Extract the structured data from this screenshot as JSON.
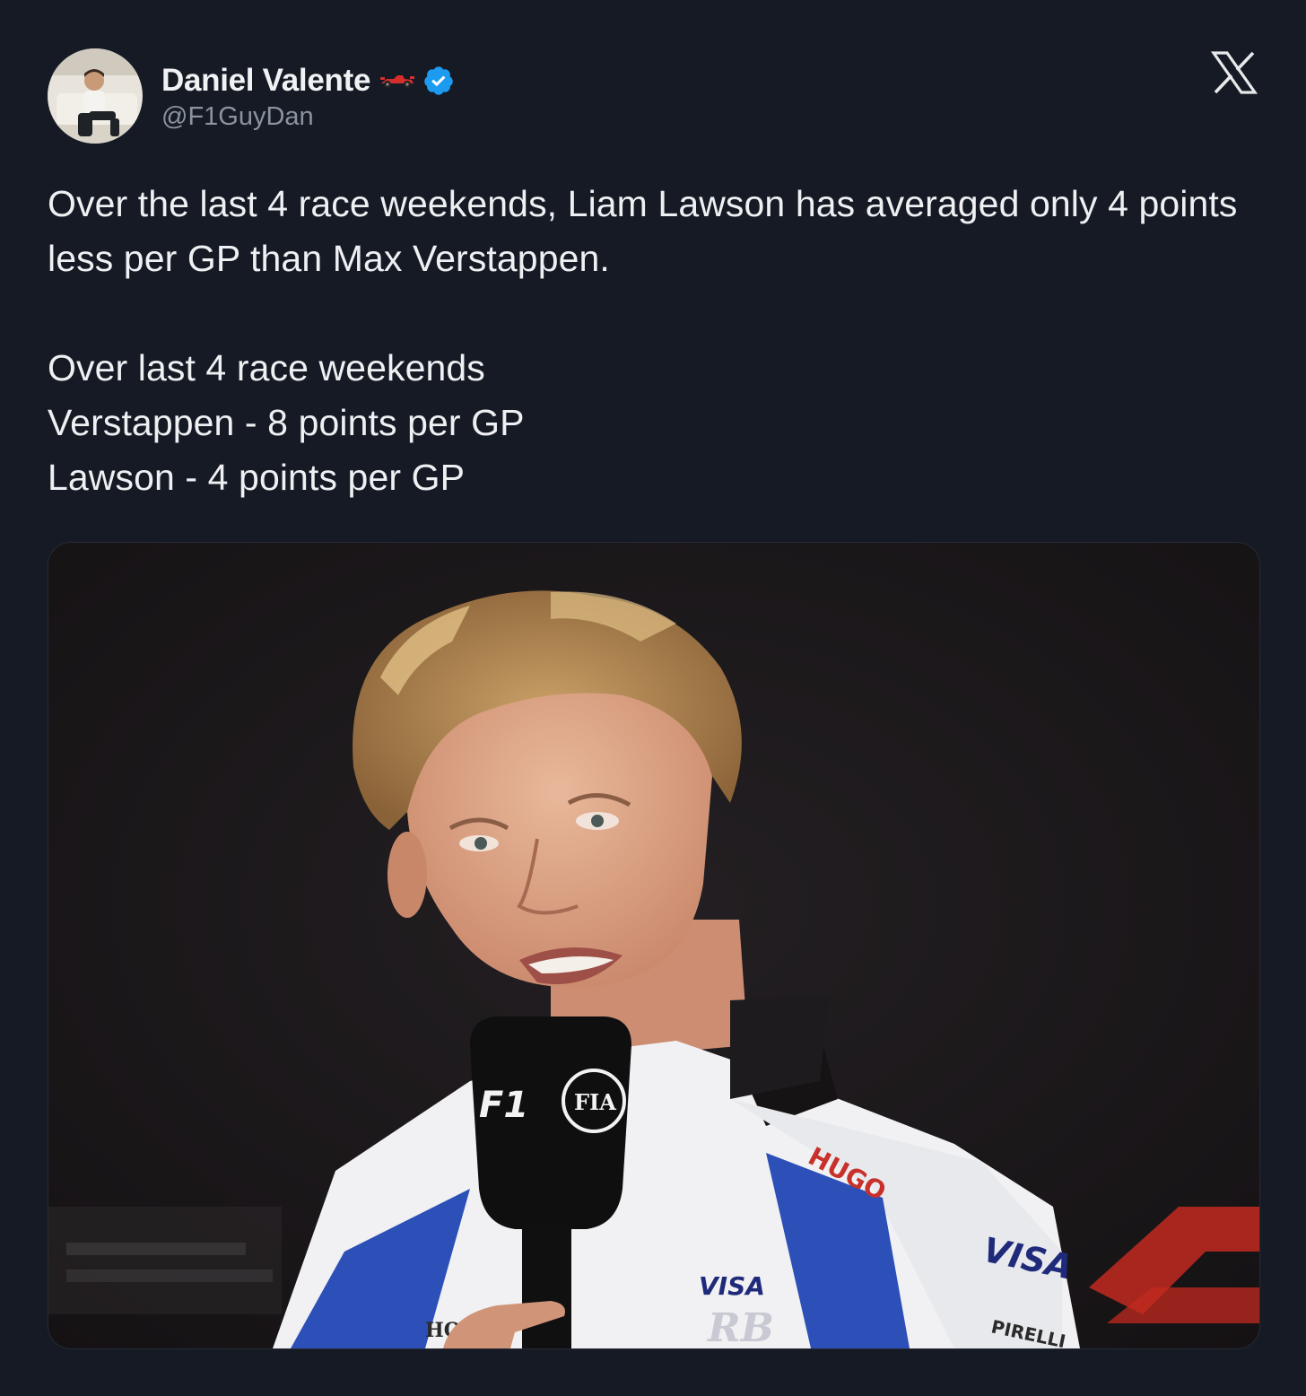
{
  "author": {
    "display_name": "Daniel Valente",
    "handle": "@F1GuyDan",
    "verified": true,
    "emoji_icon": "racing-car-icon",
    "verified_color": "#1d9bf0"
  },
  "platform": {
    "logo": "x-logo-icon"
  },
  "tweet": {
    "line1": "Over the last 4 race weekends, Liam Lawson has averaged only 4 points less per GP than Max Verstappen.",
    "line2": "Over last 4 race weekends",
    "line3": "Verstappen - 8 points per GP",
    "line4": "Lawson - 4 points per GP"
  },
  "media": {
    "mic_brand_1": "F1",
    "mic_brand_2": "FIA",
    "jacket_text_1": "HUGO",
    "jacket_text_2": "VISA",
    "jacket_text_3": "VISA",
    "jacket_text_4": "RB",
    "jacket_text_5": "HON",
    "jacket_text_6": "PIRELLI"
  },
  "colors": {
    "background": "#151a25",
    "text": "#eef0f2",
    "muted": "#8b949e",
    "accent": "#1d9bf0"
  }
}
